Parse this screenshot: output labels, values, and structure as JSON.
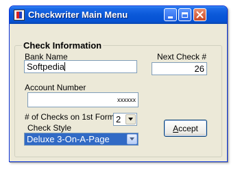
{
  "window": {
    "title": "Checkwriter Main Menu"
  },
  "group": {
    "title": "Check Information"
  },
  "bank": {
    "label": "Bank Name",
    "value": "Softpedia"
  },
  "next_check": {
    "label": "Next Check #",
    "value": "26"
  },
  "account": {
    "label": "Account Number",
    "value": "xxxxxx"
  },
  "checks_per_form": {
    "label": "# of Checks on 1st Form",
    "value": "2"
  },
  "check_style": {
    "label": "Check Style",
    "value": "Deluxe 3-On-A-Page"
  },
  "accept": {
    "label_first": "A",
    "label_rest": "ccept"
  }
}
